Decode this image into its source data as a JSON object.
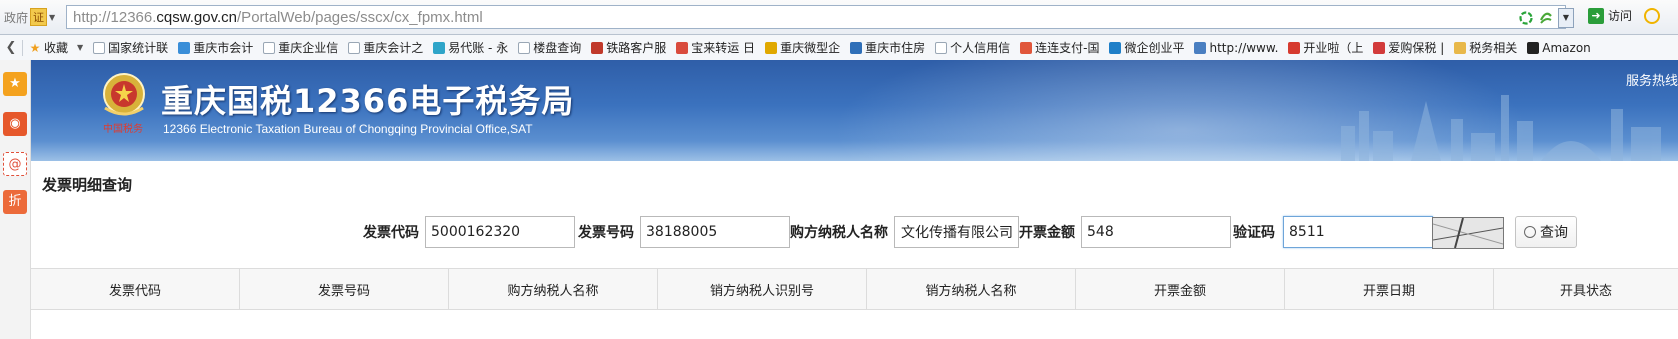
{
  "browser": {
    "zone_label": "政府",
    "cert_label": "证",
    "url_prefix": "http://12366.",
    "url_domain": "cqsw.gov.cn",
    "url_path": "/PortalWeb/pages/sscx/cx_fpmx.html",
    "visit_label": "访问",
    "bookmarks": [
      {
        "label": "收藏",
        "icon": "star-icon",
        "color": "#f0a020"
      },
      {
        "label": "国家统计联",
        "icon": "page-icon",
        "color": "#9aa7b5"
      },
      {
        "label": "重庆市会计",
        "icon": "site-icon",
        "color": "#3a8ed8"
      },
      {
        "label": "重庆企业信",
        "icon": "page-icon",
        "color": "#9aa7b5"
      },
      {
        "label": "重庆会计之",
        "icon": "page-icon",
        "color": "#9aa7b5"
      },
      {
        "label": "易代账 - 永",
        "icon": "site-icon",
        "color": "#2fa5c9"
      },
      {
        "label": "楼盘查询",
        "icon": "page-icon",
        "color": "#9aa7b5"
      },
      {
        "label": "铁路客户服",
        "icon": "rail-icon",
        "color": "#c0392b"
      },
      {
        "label": "宝来转运 日",
        "icon": "site-icon",
        "color": "#d94b3d"
      },
      {
        "label": "重庆微型企",
        "icon": "site-icon",
        "color": "#e0a800"
      },
      {
        "label": "重庆市住房",
        "icon": "site-icon",
        "color": "#2f6fb8"
      },
      {
        "label": "个人信用信",
        "icon": "page-icon",
        "color": "#9aa7b5"
      },
      {
        "label": "连连支付-国",
        "icon": "site-icon",
        "color": "#e0563b"
      },
      {
        "label": "微企创业平",
        "icon": "site-icon",
        "color": "#1f7fc8"
      },
      {
        "label": "http://www.",
        "icon": "globe-icon",
        "color": "#4a7fc1"
      },
      {
        "label": "开业啦（上",
        "icon": "site-icon",
        "color": "#d63a2f"
      },
      {
        "label": "爱购保税 |",
        "icon": "site-icon",
        "color": "#d23b3b"
      },
      {
        "label": "税务相关",
        "icon": "folder-icon",
        "color": "#e8b84a"
      },
      {
        "label": "Amazon",
        "icon": "amazon-icon",
        "color": "#222222"
      }
    ]
  },
  "banner": {
    "title": "重庆国税12366电子税务局",
    "subtitle": "12366 Electronic Taxation Bureau of Chongqing Provincial Office,SAT",
    "hotline": "服务热线"
  },
  "page": {
    "title": "发票明细查询"
  },
  "form": {
    "invoice_code_label": "发票代码",
    "invoice_code_value": "5000162320",
    "invoice_number_label": "发票号码",
    "invoice_number_value": "38188005",
    "buyer_name_label": "购方纳税人名称",
    "buyer_name_value": "文化传播有限公司",
    "amount_label": "开票金额",
    "amount_value": "548",
    "captcha_label": "验证码",
    "captcha_value": "8511",
    "query_label": "查询"
  },
  "table": {
    "headers": [
      "发票代码",
      "发票号码",
      "购方纳税人名称",
      "销方纳税人识别号",
      "销方纳税人名称",
      "开票金额",
      "开票日期",
      "开具状态"
    ]
  }
}
